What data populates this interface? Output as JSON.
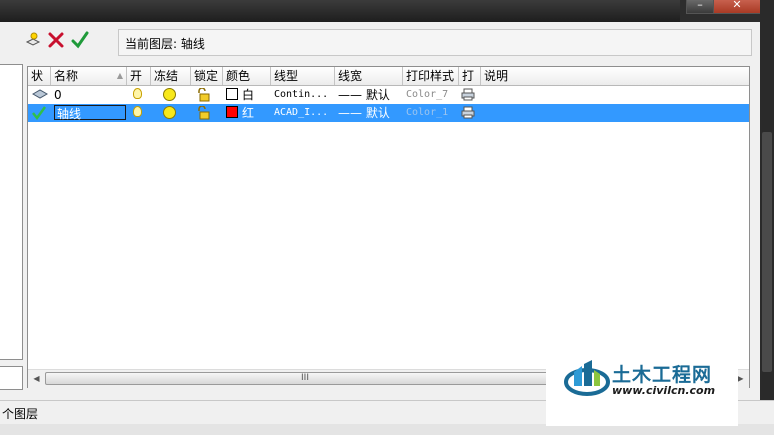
{
  "toolbar": {
    "new_layer_icon": "new-layer-icon",
    "delete_layer_icon": "delete-icon",
    "set_current_icon": "checkmark-icon",
    "current_layer_text": "当前图层: 轴线"
  },
  "table": {
    "columns": [
      {
        "key": "status",
        "label": "状"
      },
      {
        "key": "name",
        "label": "名称"
      },
      {
        "key": "on",
        "label": "开"
      },
      {
        "key": "freeze",
        "label": "冻结"
      },
      {
        "key": "lock",
        "label": "锁定"
      },
      {
        "key": "color",
        "label": "颜色"
      },
      {
        "key": "linetype",
        "label": "线型"
      },
      {
        "key": "lineweight",
        "label": "线宽"
      },
      {
        "key": "plotstyle",
        "label": "打印样式"
      },
      {
        "key": "plot",
        "label": "打"
      },
      {
        "key": "desc",
        "label": "说明"
      }
    ],
    "rows": [
      {
        "name": "0",
        "color_name": "白",
        "color_hex": "#ffffff",
        "linetype": "Contin...",
        "lineweight": "—— 默认",
        "plotstyle": "Color_7",
        "selected": false
      },
      {
        "name": "轴线",
        "color_name": "红",
        "color_hex": "#ff0000",
        "linetype": "ACAD_I...",
        "lineweight": "—— 默认",
        "plotstyle": "Color_1",
        "selected": true
      }
    ]
  },
  "scrollbar": {
    "thumb_grip": "III"
  },
  "status_bar": {
    "text": "个图层"
  },
  "watermark": {
    "title": "土木工程网",
    "url": "www.civilcn.com"
  },
  "colors": {
    "selection": "#3399ff",
    "accent": "#1a6b96"
  }
}
